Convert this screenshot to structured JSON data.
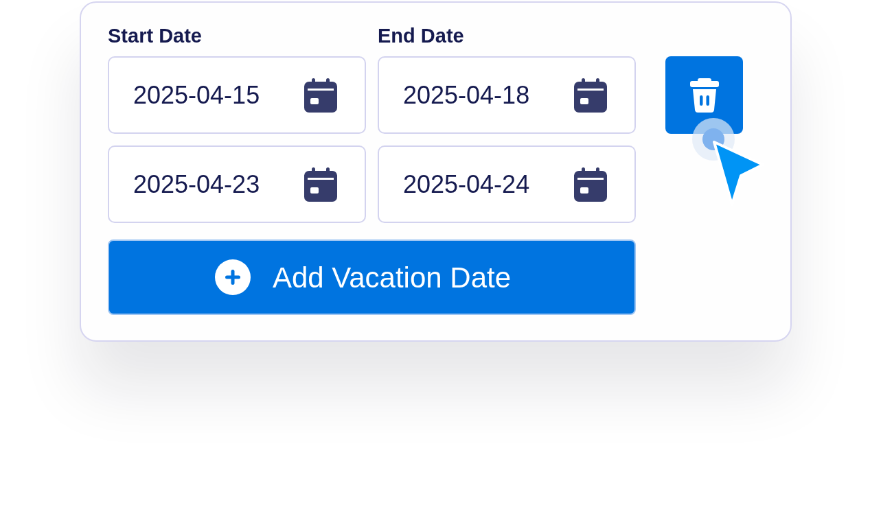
{
  "columns": [
    {
      "label": "Start Date"
    },
    {
      "label": "End Date"
    }
  ],
  "rows": [
    {
      "start": "2025-04-15",
      "end": "2025-04-18",
      "hovered": true
    },
    {
      "start": "2025-04-23",
      "end": "2025-04-24",
      "hovered": false
    }
  ],
  "add_button": {
    "label": "Add Vacation Date"
  }
}
